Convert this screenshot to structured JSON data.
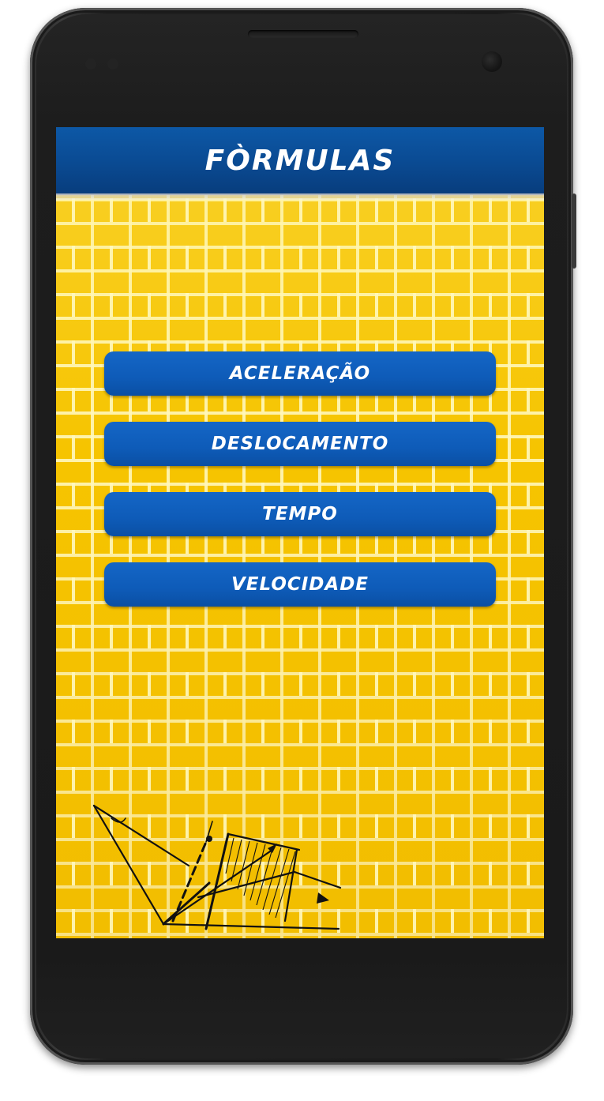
{
  "app": {
    "title": "FÒRMULAS"
  },
  "menu": {
    "items": [
      {
        "label": "ACELERAÇÃO"
      },
      {
        "label": "DESLOCAMENTO"
      },
      {
        "label": "TEMPO"
      },
      {
        "label": "VELOCIDADE"
      }
    ]
  },
  "colors": {
    "action_bar": "#0a4a92",
    "button": "#0e5bb8",
    "background": "#f6c400",
    "text": "#ffffff"
  },
  "icons": {
    "background_illustration": "physics-vector-diagram"
  }
}
